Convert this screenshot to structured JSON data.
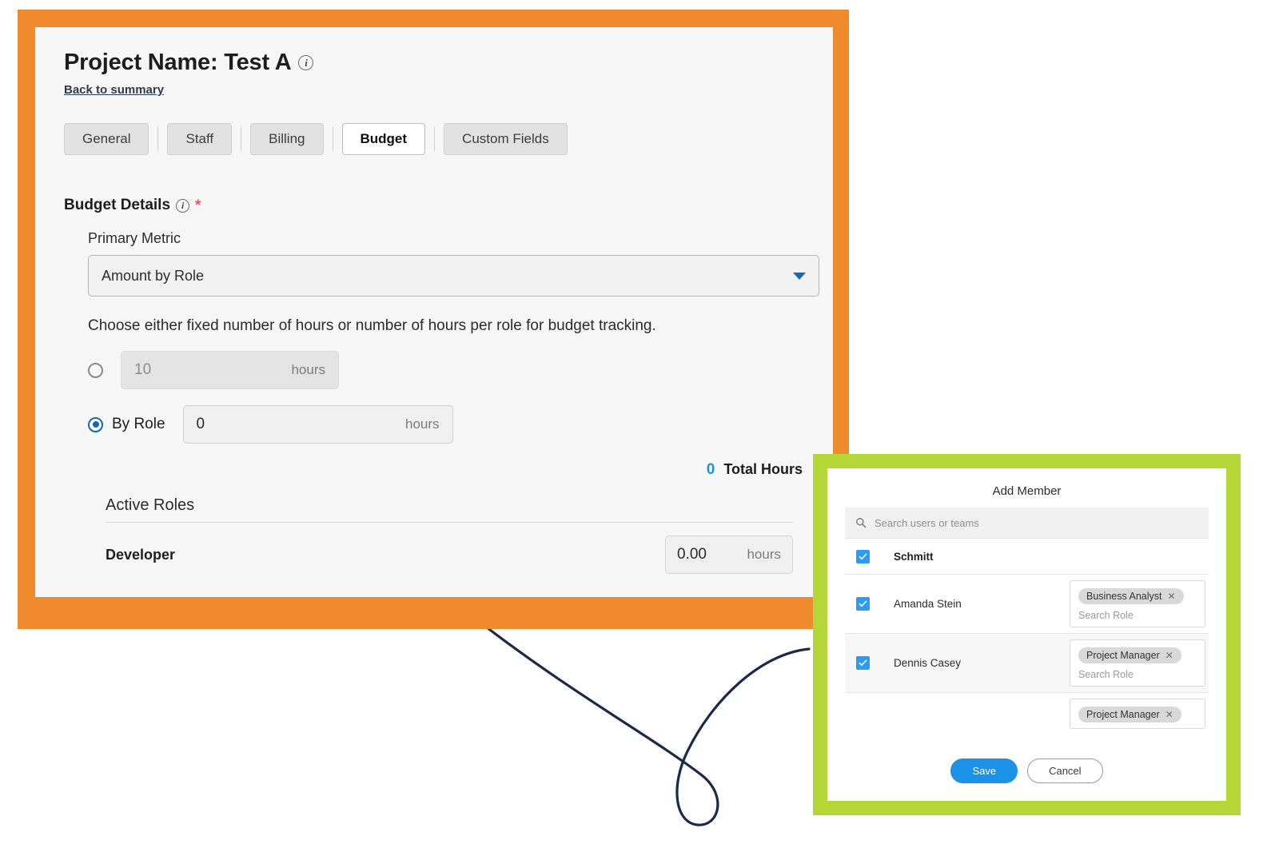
{
  "colors": {
    "orange_annotation": "#ef8a2d",
    "green_annotation": "#b5d637",
    "accent_blue": "#1b92e8",
    "select_caret_blue": "#1668b3",
    "required_red": "#e8566f",
    "connector_navy": "#1b2a4a"
  },
  "project_page": {
    "title": "Project Name: Test A",
    "title_info_icon": "info-icon",
    "back_link": "Back to summary",
    "tabs": [
      {
        "label": "General",
        "active": false
      },
      {
        "label": "Staff",
        "active": false
      },
      {
        "label": "Billing",
        "active": false
      },
      {
        "label": "Budget",
        "active": true
      },
      {
        "label": "Custom Fields",
        "active": false
      }
    ],
    "budget_details": {
      "section_title": "Budget Details",
      "info_icon": "info-icon",
      "required_marker": "*",
      "primary_metric": {
        "label": "Primary Metric",
        "value": "Amount by Role",
        "caret_icon": "chevron-down-icon"
      },
      "helper_text": "Choose either fixed number of hours or number of hours per role for budget tracking.",
      "fixed_option": {
        "selected": false,
        "value": "10",
        "unit": "hours",
        "disabled": true
      },
      "by_role_option": {
        "selected": true,
        "label": "By Role",
        "value": "0",
        "unit": "hours"
      },
      "totals": {
        "value": "0",
        "label": "Total Hours"
      },
      "active_roles": {
        "heading": "Active Roles",
        "rows": [
          {
            "name": "Developer",
            "hours": "0.00",
            "unit": "hours"
          }
        ]
      }
    }
  },
  "add_member_dialog": {
    "title": "Add Member",
    "search": {
      "icon": "search-icon",
      "placeholder": "Search users or teams"
    },
    "rows": [
      {
        "name": "Schmitt",
        "is_group": true,
        "checked": true,
        "shaded": false,
        "has_role_picker": false,
        "chip": "",
        "role_placeholder": ""
      },
      {
        "name": "Amanda Stein",
        "is_group": false,
        "checked": true,
        "shaded": false,
        "has_role_picker": true,
        "chip": "Business Analyst",
        "role_placeholder": "Search Role"
      },
      {
        "name": "Dennis Casey",
        "is_group": false,
        "checked": true,
        "shaded": true,
        "has_role_picker": true,
        "chip": "Project Manager",
        "role_placeholder": "Search Role"
      },
      {
        "name": "",
        "is_group": false,
        "checked": false,
        "shaded": false,
        "has_role_picker": true,
        "chip": "Project Manager",
        "role_placeholder": "",
        "clipped": true
      }
    ],
    "chip_remove_icon": "close-icon",
    "save_label": "Save",
    "cancel_label": "Cancel"
  }
}
